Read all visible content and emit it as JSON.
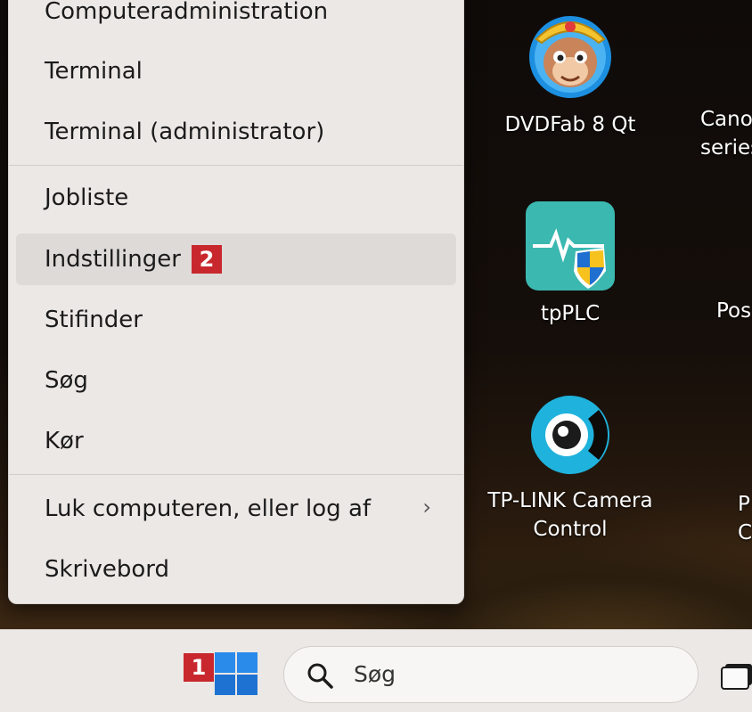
{
  "menu": {
    "items": [
      {
        "label": "Computeradministration"
      },
      {
        "label": "Terminal"
      },
      {
        "label": "Terminal (administrator)"
      },
      {
        "label": "Jobliste"
      },
      {
        "label": "Indstillinger",
        "badge": "2",
        "highlighted": true
      },
      {
        "label": "Stifinder"
      },
      {
        "label": "Søg"
      },
      {
        "label": "Kør"
      },
      {
        "label": "Luk computeren, eller log af",
        "submenu": true
      },
      {
        "label": "Skrivebord"
      }
    ],
    "chevron": "›"
  },
  "desktop": {
    "icons": [
      {
        "label": "DVDFab 8 Qt",
        "icon": "monkey-king-icon"
      },
      {
        "label": "Cano series",
        "icon": "canon-icon"
      },
      {
        "label": "tpPLC",
        "icon": "tpplc-shield-icon"
      },
      {
        "label": "Pos",
        "icon": "app-icon"
      },
      {
        "label": "TP-LINK Camera Control",
        "line1": "TP-LINK Camera",
        "line2": "Control",
        "icon": "camera-lens-icon"
      },
      {
        "label": "P C",
        "icon": "app-icon"
      }
    ]
  },
  "taskbar": {
    "start_badge": "1",
    "search_placeholder": "Søg",
    "colors": {
      "accent": "#0078d4",
      "badge": "#c8282d"
    }
  }
}
